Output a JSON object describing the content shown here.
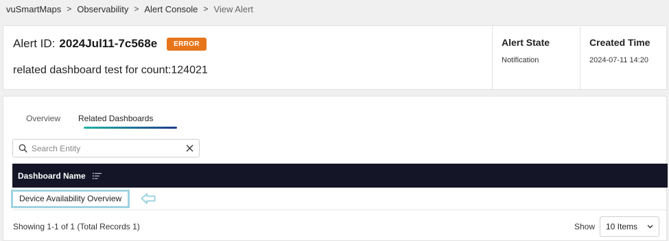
{
  "breadcrumb": {
    "items": [
      "vuSmartMaps",
      "Observability",
      "Alert Console",
      "View Alert"
    ],
    "separator": ">"
  },
  "header": {
    "alert_id_label": "Alert ID:",
    "alert_id_value": "2024Jul11-7c568e",
    "badge": "ERROR",
    "description": "related dashboard test for count:124021",
    "alert_state_title": "Alert State",
    "alert_state_value": "Notification",
    "created_time_title": "Created Time",
    "created_time_value": "2024-07-11 14:20"
  },
  "tabs": [
    {
      "label": "Overview",
      "active": false
    },
    {
      "label": "Related Dashboards",
      "active": true
    }
  ],
  "search": {
    "placeholder": "Search Entity",
    "value": ""
  },
  "table": {
    "columns": [
      "Dashboard Name"
    ],
    "rows": [
      [
        "Device Availability Overview"
      ]
    ]
  },
  "footer": {
    "showing": "Showing 1-1 of 1 (Total Records 1)",
    "show_label": "Show",
    "page_size": "10 Items"
  },
  "colors": {
    "badge": "#e8751a",
    "table_header": "#141627",
    "tab_underline_start": "#22b2a7",
    "tab_underline_end": "#1e3a8a",
    "highlight": "#9fd3e0"
  },
  "icons": [
    "chevron-right-icon",
    "search-icon",
    "close-icon",
    "sort-icon",
    "left-arrow-icon",
    "chevron-down-icon"
  ]
}
